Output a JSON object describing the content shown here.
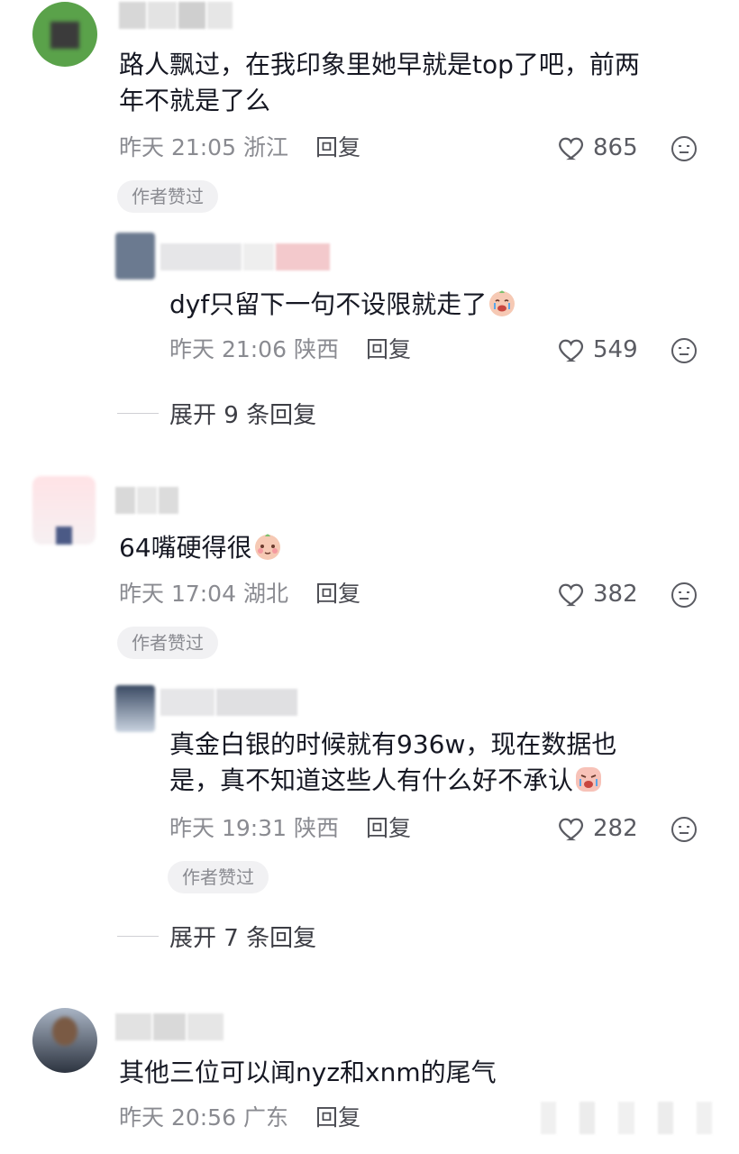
{
  "comments": [
    {
      "text": "路人飘过，在我印象里她早就是top了吧，前两年不就是了么",
      "line1": "路人飘过，在我印象里她早就是top了吧，前两",
      "line2": "年不就是了么",
      "meta": "昨天 21:05 浙江",
      "reply": "回复",
      "likes": "865",
      "badge": "作者赞过",
      "reply_item": {
        "text": "dyf只留下一句不设限就走了",
        "meta": "昨天 21:06 陕西",
        "reply": "回复",
        "likes": "549"
      },
      "expand": "展开 9 条回复"
    },
    {
      "text": "64嘴硬得很",
      "meta": "昨天 17:04 湖北",
      "reply": "回复",
      "likes": "382",
      "badge": "作者赞过",
      "reply_item": {
        "line1": "真金白银的时候就有936w，现在数据也",
        "line2": "是，真不知道这些人有什么好不承认",
        "meta": "昨天 19:31 陕西",
        "reply": "回复",
        "likes": "282",
        "badge": "作者赞过"
      },
      "expand": "展开 7 条回复"
    },
    {
      "text": "其他三位可以闻nyz和xnm的尾气",
      "meta": "昨天 20:56 广东",
      "reply": "回复"
    }
  ],
  "colors": {
    "text": "#161823",
    "meta": "#8a8b91",
    "badge_bg": "#f1f1f3"
  }
}
